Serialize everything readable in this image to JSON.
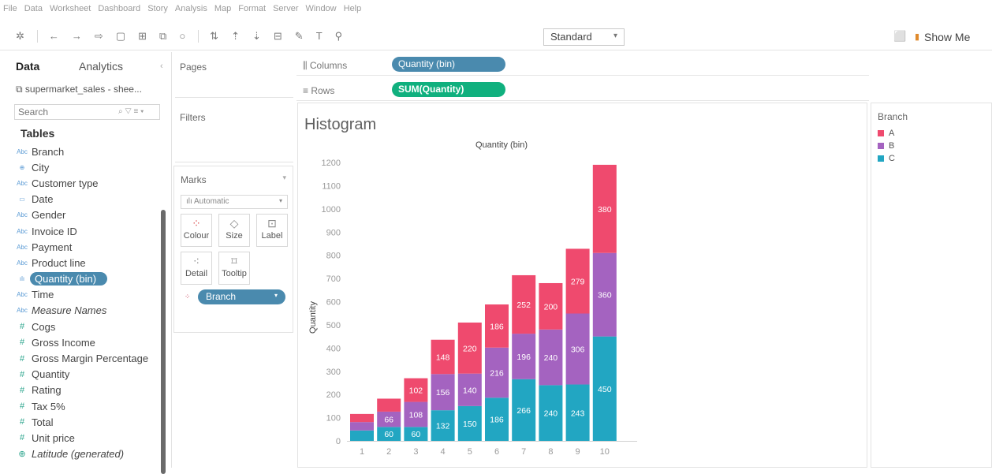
{
  "menu": [
    "File",
    "Data",
    "Worksheet",
    "Dashboard",
    "Story",
    "Analysis",
    "Map",
    "Format",
    "Server",
    "Window",
    "Help"
  ],
  "toolbar": {
    "fit_select": "Standard",
    "show_me": "Show Me"
  },
  "data_pane": {
    "tab_data": "Data",
    "tab_analytics": "Analytics",
    "datasource": "supermarket_sales - shee...",
    "search_placeholder": "Search",
    "tables_title": "Tables",
    "fields": [
      {
        "name": "Branch",
        "kind": "dimension",
        "icon": "Abc"
      },
      {
        "name": "City",
        "kind": "dimension",
        "icon": "⊕"
      },
      {
        "name": "Customer type",
        "kind": "dimension",
        "icon": "Abc"
      },
      {
        "name": "Date",
        "kind": "dimension",
        "icon": "▭"
      },
      {
        "name": "Gender",
        "kind": "dimension",
        "icon": "Abc"
      },
      {
        "name": "Invoice ID",
        "kind": "dimension",
        "icon": "Abc"
      },
      {
        "name": "Payment",
        "kind": "dimension",
        "icon": "Abc"
      },
      {
        "name": "Product line",
        "kind": "dimension",
        "icon": "Abc"
      },
      {
        "name": "Quantity (bin)",
        "kind": "dimension",
        "icon": "ılı",
        "selected": true
      },
      {
        "name": "Time",
        "kind": "dimension",
        "icon": "Abc"
      },
      {
        "name": "Measure Names",
        "kind": "dimension",
        "icon": "Abc",
        "italic": true
      },
      {
        "name": "Cogs",
        "kind": "measure",
        "icon": "#"
      },
      {
        "name": "Gross Income",
        "kind": "measure",
        "icon": "#"
      },
      {
        "name": "Gross Margin Percentage",
        "kind": "measure",
        "icon": "#"
      },
      {
        "name": "Quantity",
        "kind": "measure",
        "icon": "#"
      },
      {
        "name": "Rating",
        "kind": "measure",
        "icon": "#"
      },
      {
        "name": "Tax 5%",
        "kind": "measure",
        "icon": "#"
      },
      {
        "name": "Total",
        "kind": "measure",
        "icon": "#"
      },
      {
        "name": "Unit price",
        "kind": "measure",
        "icon": "#"
      },
      {
        "name": "Latitude (generated)",
        "kind": "measure",
        "icon": "⊕",
        "italic": true
      }
    ]
  },
  "cards": {
    "pages": "Pages",
    "filters": "Filters",
    "marks": "Marks",
    "mark_type": "Automatic",
    "colour": "Colour",
    "size": "Size",
    "label": "Label",
    "detail": "Detail",
    "tooltip": "Tooltip",
    "branch_pill": "Branch"
  },
  "shelves": {
    "columns_label": "Columns",
    "columns_pill": "Quantity (bin)",
    "rows_label": "Rows",
    "rows_pill": "SUM(Quantity)"
  },
  "legend": {
    "title": "Branch",
    "items": [
      {
        "label": "A",
        "color": "#ef4a6e"
      },
      {
        "label": "B",
        "color": "#a463c0"
      },
      {
        "label": "C",
        "color": "#22a6c2"
      }
    ]
  },
  "chart_data": {
    "type": "bar",
    "stacked": true,
    "title": "Histogram",
    "subtitle": "Quantity (bin)",
    "xlabel": "",
    "ylabel": "Quantity",
    "ylim": [
      0,
      1200
    ],
    "yticks": [
      0,
      100,
      200,
      300,
      400,
      500,
      600,
      700,
      800,
      900,
      1000,
      1100,
      1200
    ],
    "categories": [
      "1",
      "2",
      "3",
      "4",
      "5",
      "6",
      "7",
      "8",
      "9",
      "10"
    ],
    "series": [
      {
        "name": "C",
        "color": "#22a6c2",
        "values": [
          45,
          60,
          60,
          132,
          150,
          186,
          266,
          240,
          243,
          450
        ]
      },
      {
        "name": "B",
        "color": "#a463c0",
        "values": [
          36,
          66,
          108,
          156,
          140,
          216,
          196,
          240,
          306,
          360
        ]
      },
      {
        "name": "A",
        "color": "#ef4a6e",
        "values": [
          35,
          56,
          102,
          148,
          220,
          186,
          252,
          200,
          279,
          380
        ]
      }
    ],
    "shown_labels": [
      [
        false,
        true,
        true,
        true,
        true,
        true,
        true,
        true,
        true,
        true
      ],
      [
        false,
        true,
        true,
        true,
        true,
        true,
        true,
        true,
        true,
        true
      ],
      [
        false,
        false,
        true,
        true,
        true,
        true,
        true,
        true,
        true,
        true
      ]
    ]
  }
}
